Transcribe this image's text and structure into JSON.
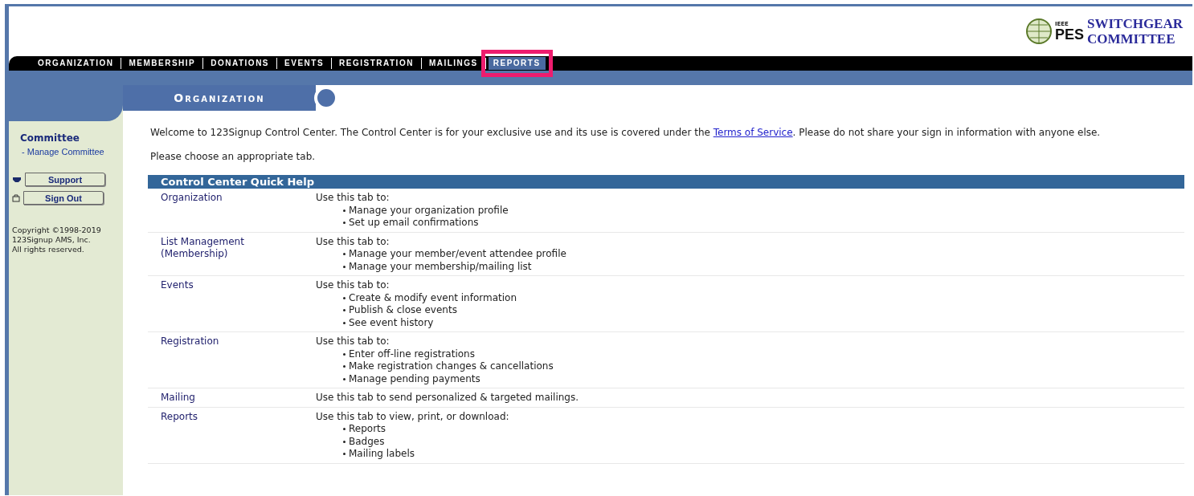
{
  "logo": {
    "small": "IEEE",
    "mark": "PES",
    "title_lines": [
      "SWITCHGEAR",
      "COMMITTEE"
    ]
  },
  "tabs": [
    {
      "label": "ORGANIZATION",
      "highlighted": false
    },
    {
      "label": "MEMBERSHIP",
      "highlighted": false
    },
    {
      "label": "DONATIONS",
      "highlighted": false
    },
    {
      "label": "EVENTS",
      "highlighted": false
    },
    {
      "label": "REGISTRATION",
      "highlighted": false
    },
    {
      "label": "MAILINGS",
      "highlighted": false
    },
    {
      "label": "REPORTS",
      "highlighted": true
    }
  ],
  "section_title": "Organization",
  "sidebar": {
    "heading": "Committee",
    "link": "- Manage Committee",
    "buttons": [
      {
        "label": "Support",
        "kind": "support"
      },
      {
        "label": "Sign Out",
        "kind": "signout"
      }
    ],
    "copyright": [
      "Copyright ©1998-2019",
      "123Signup AMS, Inc.",
      "All rights reserved."
    ]
  },
  "welcome": {
    "before": "Welcome to 123Signup Control Center. The Control Center is for your exclusive use and its use is covered under the ",
    "link": "Terms of Service",
    "after": ".   Please do not share your sign in information with anyone else."
  },
  "choose": "Please choose an appropriate tab.",
  "help": {
    "title": "Control Center Quick Help",
    "rows": [
      {
        "name": "Organization",
        "intro": "Use this tab to:",
        "items": [
          "Manage your organization profile",
          "Set up email confirmations"
        ]
      },
      {
        "name": "List Management (Membership)",
        "intro": "Use this tab to:",
        "items": [
          "Manage your member/event attendee profile",
          "Manage your membership/mailing list"
        ]
      },
      {
        "name": "Events",
        "intro": "Use this tab to:",
        "items": [
          "Create & modify event information",
          "Publish & close events",
          "See event history"
        ]
      },
      {
        "name": "Registration",
        "intro": "Use this tab to:",
        "items": [
          "Enter off-line registrations",
          "Make registration changes & cancellations",
          "Manage pending payments"
        ]
      },
      {
        "name": "Mailing",
        "intro": "Use this tab to send personalized & targeted mailings.",
        "items": []
      },
      {
        "name": "Reports",
        "intro": "Use this tab to view, print, or download:",
        "items": [
          "Reports",
          "Badges",
          "Mailing labels"
        ]
      }
    ]
  }
}
